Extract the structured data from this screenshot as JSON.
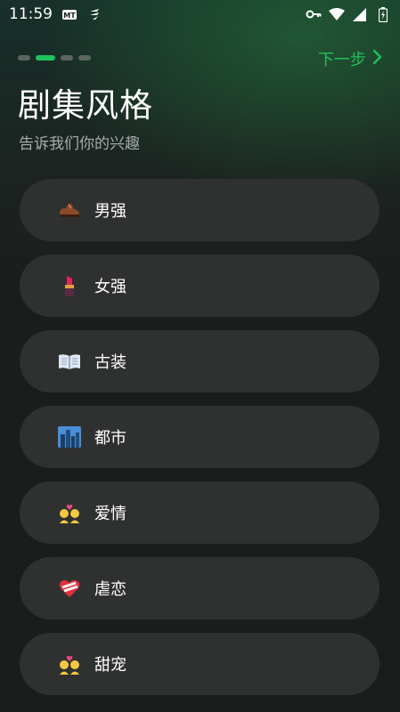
{
  "status_bar": {
    "time": "11:59",
    "icons": [
      "notification-mt-icon",
      "signal-app-icon",
      "vpn-key-icon",
      "wifi-icon",
      "cellular-icon",
      "battery-icon"
    ]
  },
  "progress": {
    "total_steps": 4,
    "current_step": 2
  },
  "header": {
    "next_label": "下一步"
  },
  "title": "剧集风格",
  "subtitle": "告诉我们你的兴趣",
  "options": [
    {
      "label": "男强",
      "icon": "shoe-icon"
    },
    {
      "label": "女强",
      "icon": "lipstick-icon"
    },
    {
      "label": "古装",
      "icon": "book-icon"
    },
    {
      "label": "都市",
      "icon": "city-icon"
    },
    {
      "label": "爱情",
      "icon": "couple-heart-icon"
    },
    {
      "label": "虐恋",
      "icon": "mended-heart-icon"
    },
    {
      "label": "甜宠",
      "icon": "couple-heart-icon"
    }
  ],
  "colors": {
    "accent": "#1fc15a",
    "card": "#2f3130",
    "background": "#1b1d1c",
    "subtitle": "#a7aba9"
  }
}
